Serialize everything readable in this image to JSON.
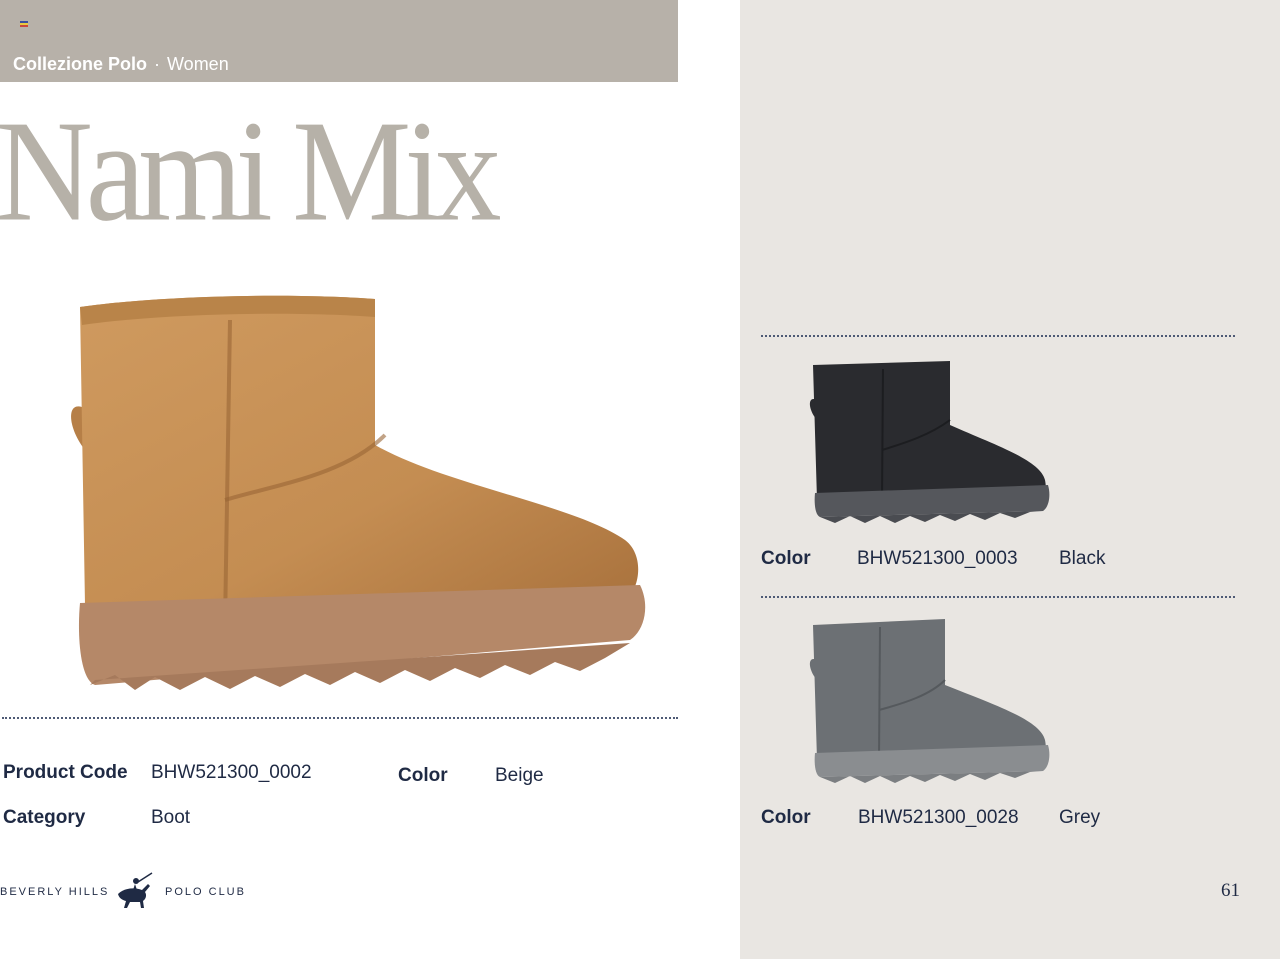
{
  "header": {
    "collection": "Collezione Polo",
    "separator": "·",
    "segment": "Women"
  },
  "product": {
    "title": "Nami Mix",
    "specs": {
      "product_code_label": "Product Code",
      "product_code": "BHW521300_0002",
      "category_label": "Category",
      "category": "Boot",
      "color_label": "Color",
      "color": "Beige"
    }
  },
  "variants": [
    {
      "color_label": "Color",
      "code": "BHW521300_0003",
      "color": "Black",
      "fill": "#2a2b2f",
      "sole": "#55575c"
    },
    {
      "color_label": "Color",
      "code": "BHW521300_0028",
      "color": "Grey",
      "fill": "#6c7074",
      "sole": "#8a8d90"
    }
  ],
  "brand": {
    "left_text": "BEVERLY HILLS",
    "right_text": "POLO CLUB"
  },
  "page_number": "61",
  "colors": {
    "header_band": "#b7b1a9",
    "title": "#b6b1a8",
    "right_panel": "#e9e6e2",
    "navy": "#1f2a44",
    "boot_beige": "#c48d52",
    "sole_beige": "#b78a68"
  }
}
